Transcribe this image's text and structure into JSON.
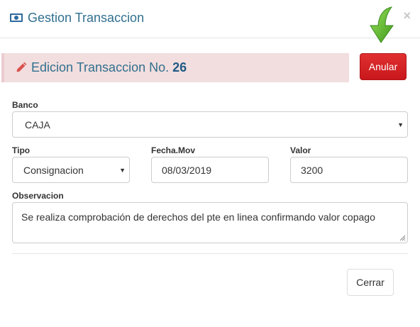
{
  "modal": {
    "title": "Gestion Transaccion",
    "close_symbol": "×"
  },
  "banner": {
    "prefix": "Edicion Transaccion No.",
    "number": "26"
  },
  "actions": {
    "anular_label": "Anular",
    "cerrar_label": "Cerrar"
  },
  "form": {
    "banco": {
      "label": "Banco",
      "value": "CAJA"
    },
    "tipo": {
      "label": "Tipo",
      "value": "Consignacion"
    },
    "fecha": {
      "label": "Fecha.Mov",
      "value": "08/03/2019"
    },
    "valor": {
      "label": "Valor",
      "value": "3200"
    },
    "observacion": {
      "label": "Observacion",
      "value": "Se realiza comprobación de derechos del pte en linea confirmando valor copago"
    }
  },
  "icons": {
    "header": "money-icon",
    "banner": "pencil-icon",
    "pointer": "green-arrow-down-icon",
    "dropdown": "caret-down-icon"
  },
  "colors": {
    "title_blue": "#31708f",
    "banner_bg": "#f2dede",
    "danger_red": "#d9242a",
    "arrow_green": "#5cb82e"
  }
}
